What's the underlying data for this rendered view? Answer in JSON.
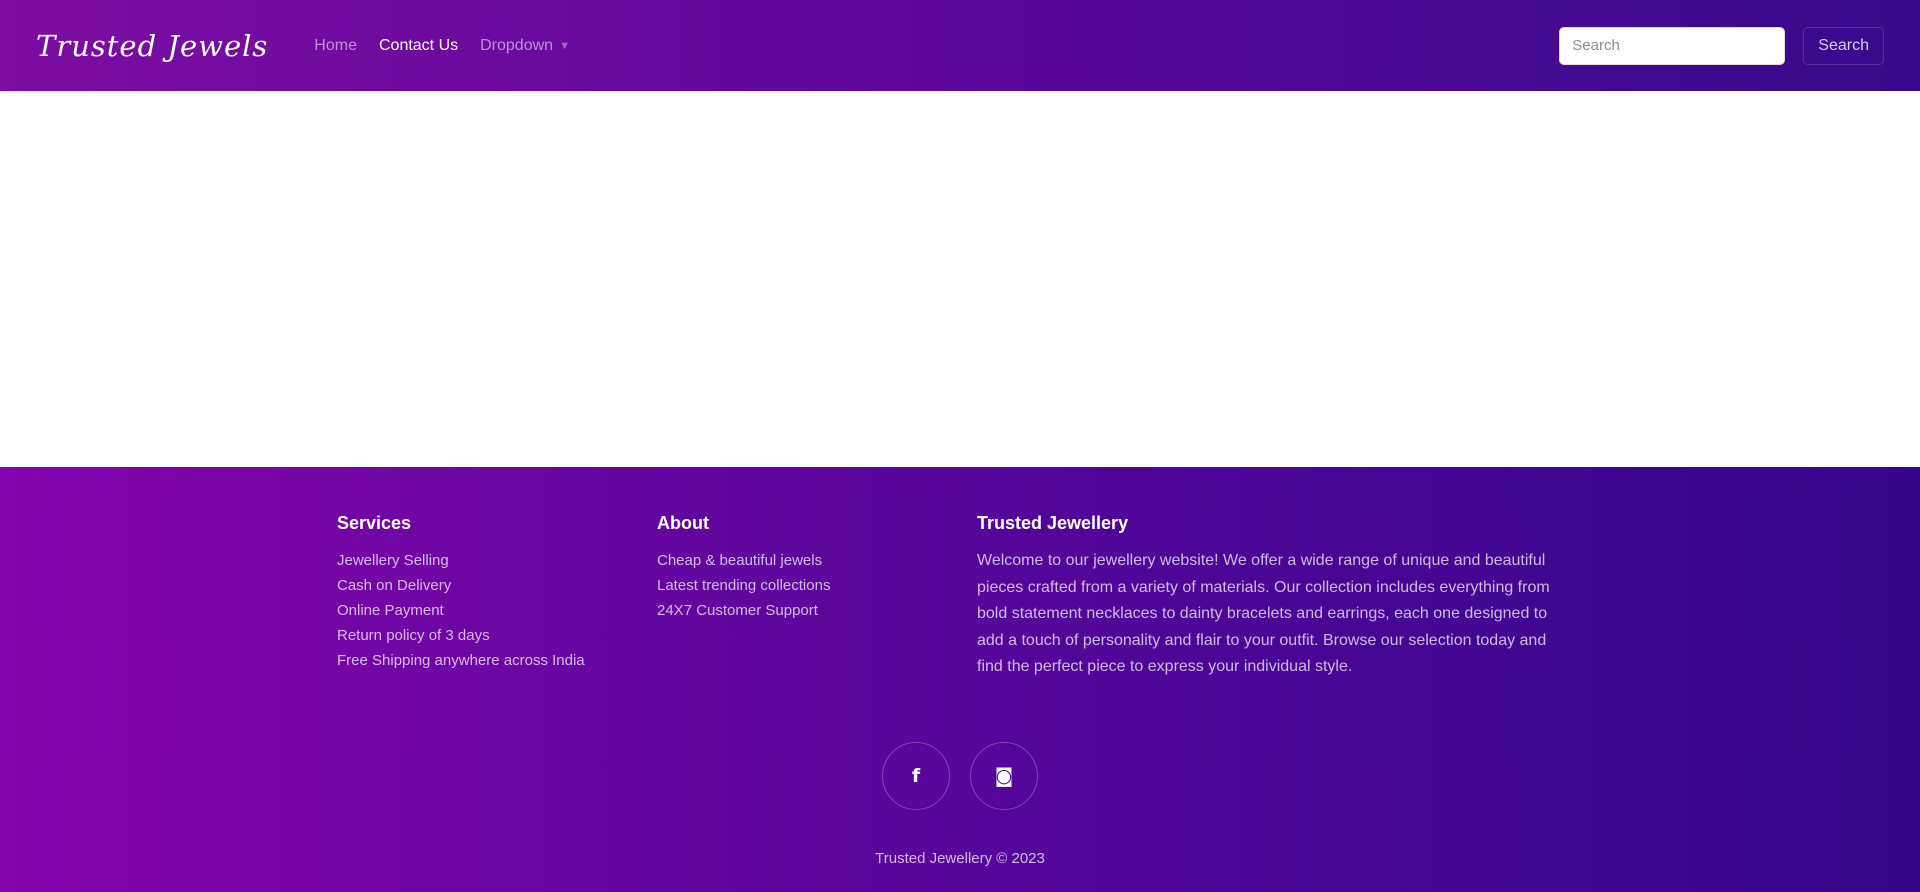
{
  "header": {
    "brand": "Trusted Jewels",
    "nav": {
      "home": "Home",
      "contact": "Contact Us",
      "dropdown": "Dropdown"
    },
    "search": {
      "placeholder": "Search",
      "button_label": "Search"
    }
  },
  "footer": {
    "services": {
      "heading": "Services",
      "items": [
        "Jewellery Selling",
        "Cash on Delivery",
        "Online Payment",
        "Return policy of 3 days",
        "Free Shipping anywhere across India"
      ]
    },
    "about": {
      "heading": "About",
      "items": [
        "Cheap & beautiful jewels",
        "Latest trending collections",
        "24X7 Customer Support"
      ]
    },
    "trusted": {
      "heading": "Trusted Jewellery",
      "description": "Welcome to our jewellery website! We offer a wide range of unique and beautiful pieces crafted from a variety of materials. Our collection includes everything from bold statement necklaces to dainty bracelets and earrings, each one designed to add a touch of personality and flair to your outfit. Browse our selection today and find the perfect piece to express your individual style."
    },
    "socials": {
      "facebook": "f",
      "instagram": "◙"
    },
    "copyright": "Trusted Jewellery © 2023"
  },
  "colors": {
    "nav_gradient_start": "#7d0da3",
    "nav_gradient_end": "#360a8b",
    "footer_gradient_start": "#8504ad",
    "footer_gradient_end": "#33078a"
  }
}
